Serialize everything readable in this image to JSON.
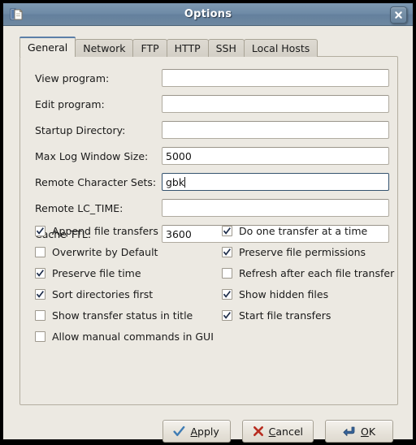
{
  "window": {
    "title": "Options",
    "icon": "document-window-icon",
    "close_label": "×",
    "titlebar_color": "#6e8aa6",
    "background_color": "#ece9e2"
  },
  "tabs": [
    {
      "label": "General",
      "selected": true
    },
    {
      "label": "Network",
      "selected": false
    },
    {
      "label": "FTP",
      "selected": false
    },
    {
      "label": "HTTP",
      "selected": false
    },
    {
      "label": "SSH",
      "selected": false
    },
    {
      "label": "Local Hosts",
      "selected": false
    }
  ],
  "fields": [
    {
      "label": "View program:",
      "value": "",
      "focused": false
    },
    {
      "label": "Edit program:",
      "value": "",
      "focused": false
    },
    {
      "label": "Startup Directory:",
      "value": "",
      "focused": false
    },
    {
      "label": "Max Log Window Size:",
      "value": "5000",
      "focused": false
    },
    {
      "label": "Remote Character Sets:",
      "value": "gbk",
      "focused": true
    },
    {
      "label": "Remote LC_TIME:",
      "value": "",
      "focused": false
    },
    {
      "label": "Cache TTL:",
      "value": "3600",
      "focused": false
    }
  ],
  "checkboxes": {
    "left": [
      {
        "label": "Append file transfers",
        "checked": true
      },
      {
        "label": "Overwrite by Default",
        "checked": false
      },
      {
        "label": "Preserve file time",
        "checked": true
      },
      {
        "label": "Sort directories first",
        "checked": true
      },
      {
        "label": "Show transfer status in title",
        "checked": false
      },
      {
        "label": "Allow manual commands in GUI",
        "checked": false
      }
    ],
    "right": [
      {
        "label": "Do one transfer at a time",
        "checked": true
      },
      {
        "label": "Preserve file permissions",
        "checked": true
      },
      {
        "label": "Refresh after each file transfer",
        "checked": false
      },
      {
        "label": "Show hidden files",
        "checked": true
      },
      {
        "label": "Start file transfers",
        "checked": true
      }
    ]
  },
  "buttons": [
    {
      "label": "Apply",
      "mnemonic": "A",
      "before": "",
      "after": "pply",
      "icon": "checkmark-icon",
      "icon_color": "#3f7cb4"
    },
    {
      "label": "Cancel",
      "mnemonic": "C",
      "before": "",
      "after": "ancel",
      "icon": "cross-icon",
      "icon_color": "#b82d21"
    },
    {
      "label": "OK",
      "mnemonic": "O",
      "before": "",
      "after": "K",
      "icon": "enter-arrow-icon",
      "icon_color": "#37649b"
    }
  ]
}
